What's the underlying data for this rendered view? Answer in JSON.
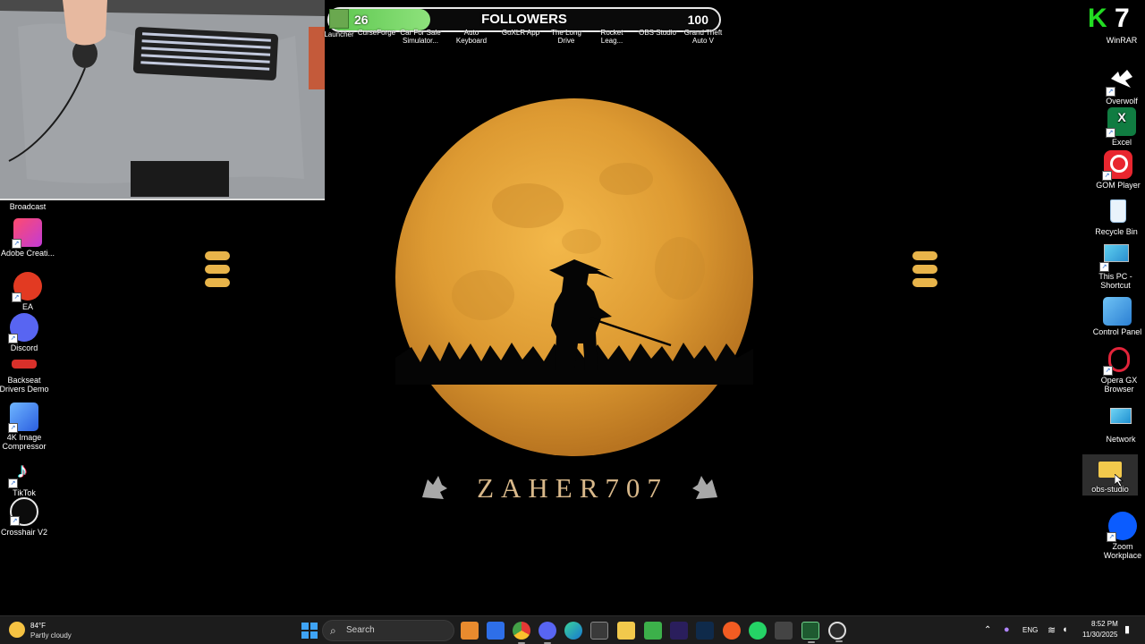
{
  "overlay": {
    "followers_current": "26",
    "followers_label": "FOLLOWERS",
    "followers_goal": "100",
    "progress_fraction": 0.26,
    "brand_badge": "K7"
  },
  "top_icons": [
    {
      "label": "Launcher",
      "icon": "minecraft-launcher-icon"
    },
    {
      "label": "CurseForge",
      "icon": "curseforge-icon"
    },
    {
      "label": "Car For Sale Simulator...",
      "icon": "car-for-sale-icon"
    },
    {
      "label": "Auto Keyboard",
      "icon": "auto-keyboard-icon"
    },
    {
      "label": "GoXLR App",
      "icon": "goxlr-icon"
    },
    {
      "label": "The Long Drive",
      "icon": "the-long-drive-icon"
    },
    {
      "label": "Rocket Leag...",
      "icon": "rocket-league-icon"
    },
    {
      "label": "OBS Studio",
      "icon": "obs-studio-icon"
    },
    {
      "label": "Grand Theft Auto V",
      "icon": "gta-v-icon"
    }
  ],
  "left_icons": [
    {
      "label": "Broadcast",
      "icon": "broadcast-icon"
    },
    {
      "label": "Adobe Creati...",
      "icon": "adobe-creative-cloud-icon"
    },
    {
      "label": "EA",
      "icon": "ea-icon"
    },
    {
      "label": "Discord",
      "icon": "discord-icon"
    },
    {
      "label": "Backseat Drivers Demo",
      "icon": "backseat-drivers-icon"
    },
    {
      "label": "4K Image Compressor",
      "icon": "image-compressor-icon"
    },
    {
      "label": "TikTok",
      "icon": "tiktok-icon"
    },
    {
      "label": "Crosshair V2",
      "icon": "crosshair-icon"
    }
  ],
  "right_icons": [
    {
      "label": "WinRAR",
      "icon": "winrar-icon"
    },
    {
      "label": "Overwolf",
      "icon": "overwolf-icon"
    },
    {
      "label": "Excel",
      "icon": "excel-icon"
    },
    {
      "label": "GOM Player",
      "icon": "gom-player-icon"
    },
    {
      "label": "Recycle Bin",
      "icon": "recycle-bin-icon"
    },
    {
      "label": "This PC - Shortcut",
      "icon": "this-pc-icon"
    },
    {
      "label": "Control Panel",
      "icon": "control-panel-icon"
    },
    {
      "label": "Opera GX Browser",
      "icon": "opera-gx-icon"
    },
    {
      "label": "Network",
      "icon": "network-icon"
    },
    {
      "label": "obs-studio",
      "icon": "folder-icon"
    },
    {
      "label": "Zoom Workplace",
      "icon": "zoom-icon"
    }
  ],
  "wallpaper": {
    "title": "ZAHER707"
  },
  "taskbar": {
    "weather_temp": "84°F",
    "weather_desc": "Partly cloudy",
    "search_label": "Search",
    "language": "ENG",
    "time": "8:52 PM",
    "date": "11/30/2025"
  },
  "colors": {
    "moon": "#e0a23c",
    "progress_green": "#6fd35d",
    "taskbar_bg": "#1c1c1c"
  }
}
